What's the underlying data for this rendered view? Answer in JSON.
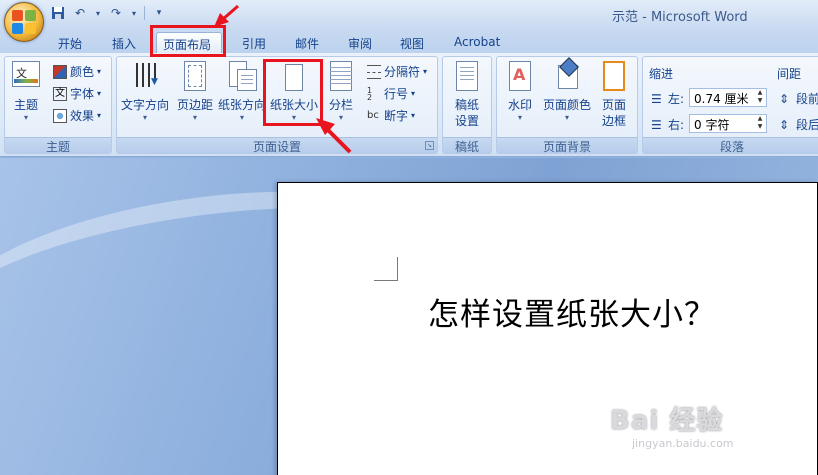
{
  "window": {
    "title": "示范 - Microsoft Word"
  },
  "qat": {
    "save_icon": "save-icon",
    "undo_icon": "undo-icon",
    "redo_icon": "redo-icon"
  },
  "tabs": [
    {
      "label": "开始"
    },
    {
      "label": "插入"
    },
    {
      "label": "页面布局",
      "active": true
    },
    {
      "label": "引用"
    },
    {
      "label": "邮件"
    },
    {
      "label": "审阅"
    },
    {
      "label": "视图"
    },
    {
      "label": "Acrobat"
    }
  ],
  "groups": {
    "theme": {
      "label": "主题",
      "theme_button": "主题",
      "colors": "颜色",
      "fonts": "字体",
      "effects": "效果"
    },
    "page_setup": {
      "label": "页面设置",
      "text_direction": "文字方向",
      "margins": "页边距",
      "orientation": "纸张方向",
      "size": "纸张大小",
      "columns": "分栏",
      "breaks": "分隔符",
      "line_numbers": "行号",
      "hyphenation": "断字"
    },
    "manuscript": {
      "label": "稿纸",
      "button_line1": "稿纸",
      "button_line2": "设置"
    },
    "page_background": {
      "label": "页面背景",
      "watermark": "水印",
      "page_color": "页面颜色",
      "borders_line1": "页面",
      "borders_line2": "边框"
    },
    "paragraph": {
      "label": "段落",
      "indent_title": "缩进",
      "spacing_title": "间距",
      "left_label": "左:",
      "left_value": "0.74 厘米",
      "right_label": "右:",
      "right_value": "0 字符",
      "before_label": "段前",
      "after_label": "段后"
    }
  },
  "document": {
    "text": "怎样设置纸张大小？"
  },
  "watermark": {
    "main": "Bai 经验",
    "sub": "jingyan.baidu.com"
  },
  "colors": {
    "annotation_red": "#e8141e"
  }
}
